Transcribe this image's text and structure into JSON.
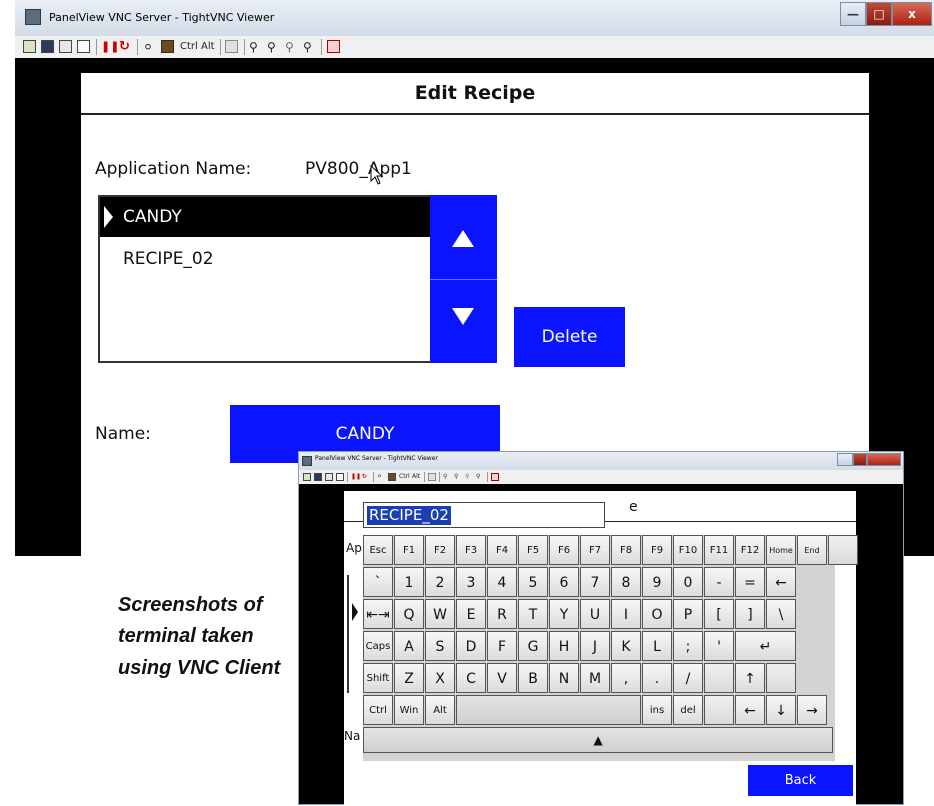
{
  "window": {
    "title": "PanelView VNC Server - TightVNC Viewer",
    "min_glyph": "—",
    "max_glyph": "□",
    "close_glyph": "x"
  },
  "toolbar": {
    "ctrl": "Ctrl",
    "alt": "Alt",
    "icons": [
      "new-connection-icon",
      "save-icon",
      "options-icon",
      "info-icon",
      "pause-icon",
      "refresh-icon",
      "ctrl-alt-del-icon",
      "send-key-icon",
      "clipboard-icon",
      "zoom-in-icon",
      "zoom-out-icon",
      "zoom-100-icon",
      "zoom-auto-icon",
      "fullscreen-icon"
    ]
  },
  "hmi": {
    "header": "Edit Recipe",
    "app_name_label": "Application Name:",
    "app_name_value": "PV800_App1",
    "recipes": [
      "CANDY",
      "RECIPE_02"
    ],
    "selected_index": 0,
    "up_glyph": "▲",
    "down_glyph": "▼",
    "delete_label": "Delete",
    "name_label": "Name:",
    "name_value": "CANDY"
  },
  "caption": {
    "line1": "Screenshots of",
    "line2": "terminal taken",
    "line3": "using VNC Client"
  },
  "popup": {
    "window_title": "PanelView VNC Server - TightVNC Viewer",
    "header_partial": "e",
    "edit_value": "RECIPE_02",
    "bg_app_partial": "Ap",
    "bg_name_partial": "Na",
    "back_label": "Back",
    "keyboard": {
      "row1": [
        "Esc",
        "F1",
        "F2",
        "F3",
        "F4",
        "F5",
        "F6",
        "F7",
        "F8",
        "F9",
        "F10",
        "F11",
        "F12",
        "Home",
        "End",
        ""
      ],
      "row2": [
        "`",
        "1",
        "2",
        "3",
        "4",
        "5",
        "6",
        "7",
        "8",
        "9",
        "0",
        "-",
        "=",
        "←"
      ],
      "row3": [
        "⇤⇥",
        "Q",
        "W",
        "E",
        "R",
        "T",
        "Y",
        "U",
        "I",
        "O",
        "P",
        "[",
        "]",
        "\\"
      ],
      "row4": [
        "Caps",
        "A",
        "S",
        "D",
        "F",
        "G",
        "H",
        "J",
        "K",
        "L",
        ";",
        "'",
        "↵"
      ],
      "row5": [
        "Shift",
        "Z",
        "X",
        "C",
        "V",
        "B",
        "N",
        "M",
        ",",
        ".",
        "/",
        "",
        "↑",
        ""
      ],
      "row6": [
        "Ctrl",
        "Win",
        "Alt",
        "",
        "ins",
        "del",
        "",
        "←",
        "↓",
        "→"
      ],
      "row7": [
        "▲"
      ]
    }
  }
}
